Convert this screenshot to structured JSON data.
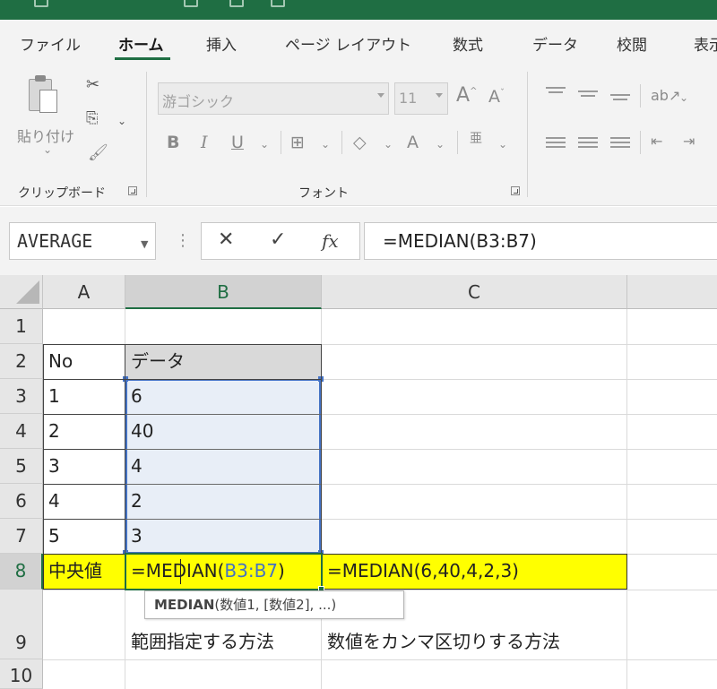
{
  "ribbon": {
    "tabs": [
      "ファイル",
      "ホーム",
      "挿入",
      "ページ レイアウト",
      "数式",
      "データ",
      "校閲",
      "表示"
    ],
    "active_tab": "ホーム",
    "clipboard": {
      "paste_label": "貼り付け",
      "group_label": "クリップボード"
    },
    "font": {
      "font_name": "游ゴシック",
      "font_size": "11",
      "group_label": "フォント"
    }
  },
  "formula_bar": {
    "name_box": "AVERAGE",
    "cancel_icon": "cancel-icon",
    "enter_icon": "check-icon",
    "fx_label": "fx",
    "formula": "=MEDIAN(B3:B7)"
  },
  "sheet": {
    "columns": [
      "A",
      "B",
      "C"
    ],
    "selected_column": "B",
    "rows": [
      "1",
      "2",
      "3",
      "4",
      "5",
      "6",
      "7",
      "8",
      "9",
      "10"
    ],
    "selected_row": "8",
    "cells": {
      "A2": "No",
      "B2": "データ",
      "A3": "1",
      "B3": "6",
      "A4": "2",
      "B4": "40",
      "A5": "3",
      "B5": "4",
      "A6": "4",
      "B6": "2",
      "A7": "5",
      "B7": "3",
      "A8": "中央値",
      "B8_a": "=ME",
      "B8_b": "DIAN(",
      "B8_ref": "B3:B7",
      "B8_c": ")",
      "C8": "=MEDIAN(6,40,4,2,3)",
      "B9": "範囲指定する方法",
      "C9": "数値をカンマ区切りする方法"
    },
    "tooltip": {
      "func": "MEDIAN",
      "args": "(数値1, [数値2], ...)"
    },
    "colors": {
      "highlight": "#ffff00",
      "range": "#4472c4",
      "accent": "#1f6e43"
    }
  }
}
